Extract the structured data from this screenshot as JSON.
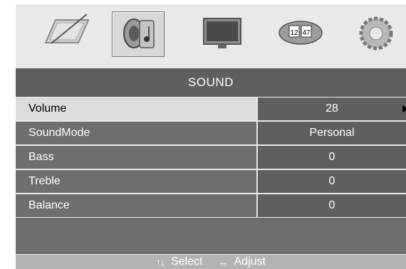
{
  "icons": [
    {
      "name": "picture-icon",
      "selected": false
    },
    {
      "name": "sound-icon",
      "selected": true
    },
    {
      "name": "screen-icon",
      "selected": false
    },
    {
      "name": "time-icon",
      "selected": false
    },
    {
      "name": "setup-icon",
      "selected": false
    }
  ],
  "time_icon_numbers": {
    "hours": "12",
    "minutes": "47"
  },
  "menu": {
    "title": "SOUND",
    "items": [
      {
        "label": "Volume",
        "value": "28",
        "selected": true
      },
      {
        "label": "SoundMode",
        "value": "Personal",
        "selected": false
      },
      {
        "label": "Bass",
        "value": "0",
        "selected": false
      },
      {
        "label": "Treble",
        "value": "0",
        "selected": false
      },
      {
        "label": "Balance",
        "value": "0",
        "selected": false
      }
    ]
  },
  "help": {
    "select_glyph": "↑↓",
    "select_label": "Select",
    "adjust_glyph": "↔",
    "adjust_label": "Adjust"
  },
  "colors": {
    "panel": "#e9e9e9",
    "title_bar": "#5f5f5f",
    "row_label": "#6e6e6e",
    "row_selected": "#dcdcdc",
    "help_bar": "#b3b3b3"
  }
}
